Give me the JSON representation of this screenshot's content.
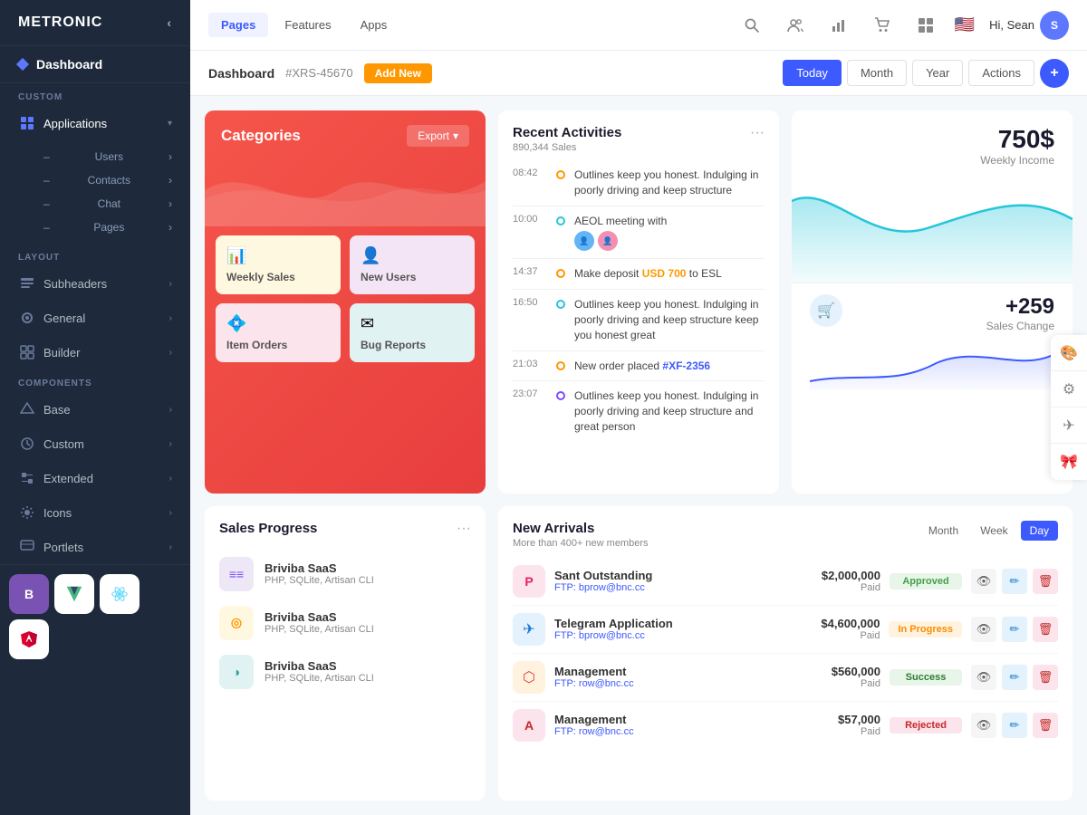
{
  "app": {
    "logo": "METRONIC",
    "nav_tabs": [
      {
        "label": "Pages",
        "active": true
      },
      {
        "label": "Features",
        "active": false
      },
      {
        "label": "Apps",
        "active": false
      }
    ],
    "user": {
      "greeting": "Hi, Sean",
      "avatar_initial": "S",
      "flag": "🇺🇸"
    },
    "topnav_icons": [
      "search",
      "users",
      "chart",
      "shopping",
      "grid"
    ]
  },
  "subheader": {
    "title": "Dashboard",
    "ref_id": "#XRS-45670",
    "add_label": "Add New",
    "buttons": [
      "Today",
      "Month",
      "Year",
      "Actions"
    ],
    "active_button": "Today",
    "plus_btn": "+"
  },
  "sidebar": {
    "logo": "METRONIC",
    "dashboard_label": "Dashboard",
    "sections": [
      {
        "name": "CUSTOM",
        "items": [
          {
            "label": "Applications",
            "icon": "grid",
            "active": true,
            "expanded": true,
            "subitems": [
              {
                "label": "Users"
              },
              {
                "label": "Contacts"
              },
              {
                "label": "Chat"
              },
              {
                "label": "Pages"
              }
            ]
          }
        ]
      },
      {
        "name": "LAYOUT",
        "items": [
          {
            "label": "Subheaders",
            "icon": "layout"
          },
          {
            "label": "General",
            "icon": "general"
          },
          {
            "label": "Builder",
            "icon": "builder"
          }
        ]
      },
      {
        "name": "COMPONENTS",
        "items": [
          {
            "label": "Base",
            "icon": "base"
          },
          {
            "label": "Custom",
            "icon": "custom"
          },
          {
            "label": "Extended",
            "icon": "extended"
          },
          {
            "label": "Icons",
            "icon": "icons"
          },
          {
            "label": "Portlets",
            "icon": "portlets"
          }
        ]
      }
    ],
    "frameworks": [
      {
        "name": "Bootstrap",
        "symbol": "B",
        "color": "#7952b3"
      },
      {
        "name": "Vue",
        "symbol": "V",
        "color": "#41b883"
      },
      {
        "name": "React",
        "symbol": "⚛",
        "color": "#61dafb"
      },
      {
        "name": "Angular",
        "symbol": "A",
        "color": "#dd0031"
      }
    ]
  },
  "categories": {
    "title": "Categories",
    "export_label": "Export",
    "items": [
      {
        "label": "Weekly Sales",
        "icon": "📊",
        "color": "yellow"
      },
      {
        "label": "New Users",
        "icon": "👤+",
        "color": "purple"
      },
      {
        "label": "Item Orders",
        "icon": "💠",
        "color": "pink"
      },
      {
        "label": "Bug Reports",
        "icon": "✉",
        "color": "teal"
      }
    ]
  },
  "activities": {
    "title": "Recent Activities",
    "subtitle": "890,344 Sales",
    "items": [
      {
        "time": "08:42",
        "dot_color": "orange",
        "text": "Outlines keep you honest. Indulging in poorly driving and keep structure",
        "has_avatars": false
      },
      {
        "time": "10:00",
        "dot_color": "teal",
        "text": "AEOL meeting with",
        "has_avatars": true
      },
      {
        "time": "14:37",
        "dot_color": "orange",
        "text": "Make deposit ",
        "highlight": "USD 700",
        "text_after": " to ESL",
        "has_avatars": false
      },
      {
        "time": "16:50",
        "dot_color": "teal",
        "text": "Outlines keep you honest. Indulging in poorly driving and keep structure keep you honest great",
        "has_avatars": false
      },
      {
        "time": "21:03",
        "dot_color": "orange",
        "text": "New order placed ",
        "highlight_blue": "#XF-2356",
        "has_avatars": false
      },
      {
        "time": "23:07",
        "dot_color": "purple",
        "text": "Outlines keep you honest. Indulging in poorly driving and keep structure and great person",
        "has_avatars": false
      }
    ]
  },
  "income": {
    "amount": "750$",
    "label": "Weekly Income",
    "sales_change_amount": "+259",
    "sales_change_label": "Sales Change"
  },
  "sales_progress": {
    "title": "Sales Progress",
    "items": [
      {
        "name": "Briviba SaaS",
        "sub": "PHP, SQLite, Artisan CLI",
        "logo_text": "≡≡",
        "logo_color": "purple"
      },
      {
        "name": "Briviba SaaS",
        "sub": "PHP, SQLite, Artisan CLI",
        "logo_text": "◎",
        "logo_color": "yellow"
      },
      {
        "name": "Briviba SaaS",
        "sub": "PHP, SQLite, Artisan CLI",
        "logo_text": "◑",
        "logo_color": "teal"
      }
    ]
  },
  "new_arrivals": {
    "title": "New Arrivals",
    "subtitle": "More than 400+ new members",
    "tabs": [
      "Month",
      "Week",
      "Day"
    ],
    "active_tab": "Day",
    "rows": [
      {
        "name": "Sant Outstanding",
        "ftp_label": "FTP:",
        "ftp_value": "bprow@bnc.cc",
        "amount": "$2,000,000",
        "paid": "Paid",
        "badge": "Approved",
        "badge_class": "approved",
        "icon": "P",
        "icon_class": "red"
      },
      {
        "name": "Telegram Application",
        "ftp_label": "FTP:",
        "ftp_value": "bprow@bnc.cc",
        "amount": "$4,600,000",
        "paid": "Paid",
        "badge": "In Progress",
        "badge_class": "inprogress",
        "icon": "✈",
        "icon_class": "blue"
      },
      {
        "name": "Management",
        "ftp_label": "FTP:",
        "ftp_value": "row@bnc.cc",
        "amount": "$560,000",
        "paid": "Paid",
        "badge": "Success",
        "badge_class": "success",
        "icon": "⬡",
        "icon_class": "red2"
      },
      {
        "name": "Management",
        "ftp_label": "FTP:",
        "ftp_value": "row@bnc.cc",
        "amount": "$57,000",
        "paid": "Paid",
        "badge": "Rejected",
        "badge_class": "rejected",
        "icon": "A",
        "icon_class": "red"
      }
    ]
  },
  "right_icons": [
    "🎨",
    "⚙",
    "✈",
    "🎀"
  ]
}
